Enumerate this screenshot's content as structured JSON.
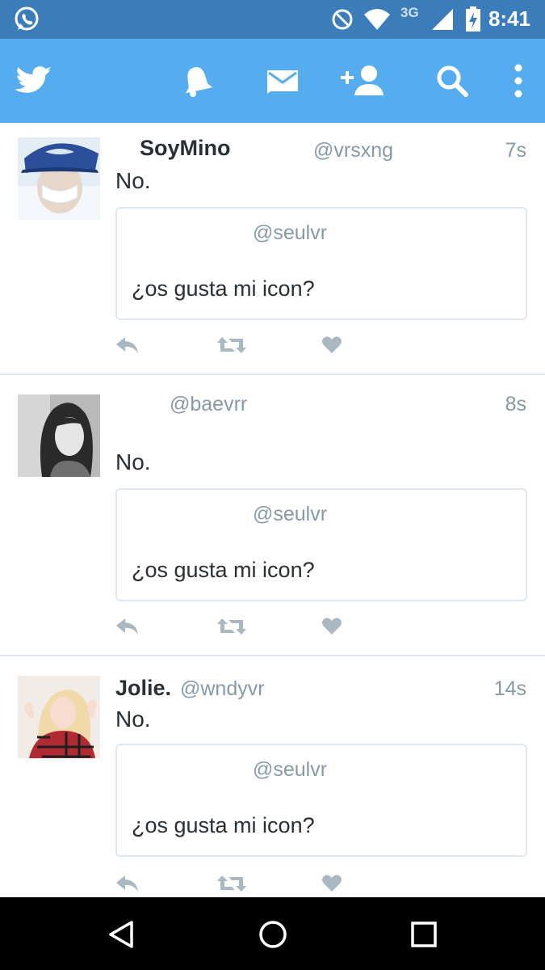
{
  "status_bar": {
    "clock": "8:41",
    "network": "3G"
  },
  "toolbar": {
    "icons": [
      "twitter-bird-icon",
      "bell-icon",
      "envelope-icon",
      "add-user-icon",
      "search-icon",
      "more-vert-icon"
    ],
    "background": "#55acee"
  },
  "tweets": [
    {
      "name": "SoyMino",
      "handle": "@vrsxng",
      "time": "7s",
      "text": "No.",
      "quote": {
        "handle": "@seulvr",
        "text": "¿os gusta mi icon?"
      }
    },
    {
      "name": "",
      "handle": "@baevrr",
      "time": "8s",
      "text": "No.",
      "quote": {
        "handle": "@seulvr",
        "text": "¿os gusta mi icon?"
      }
    },
    {
      "name": "Jolie.",
      "handle": "@wndyvr",
      "time": "14s",
      "text": "No.",
      "quote": {
        "handle": "@seulvr",
        "text": "¿os gusta mi icon?"
      }
    }
  ],
  "nav_bar": {
    "icons": [
      "back-icon",
      "home-icon",
      "recents-icon"
    ]
  }
}
